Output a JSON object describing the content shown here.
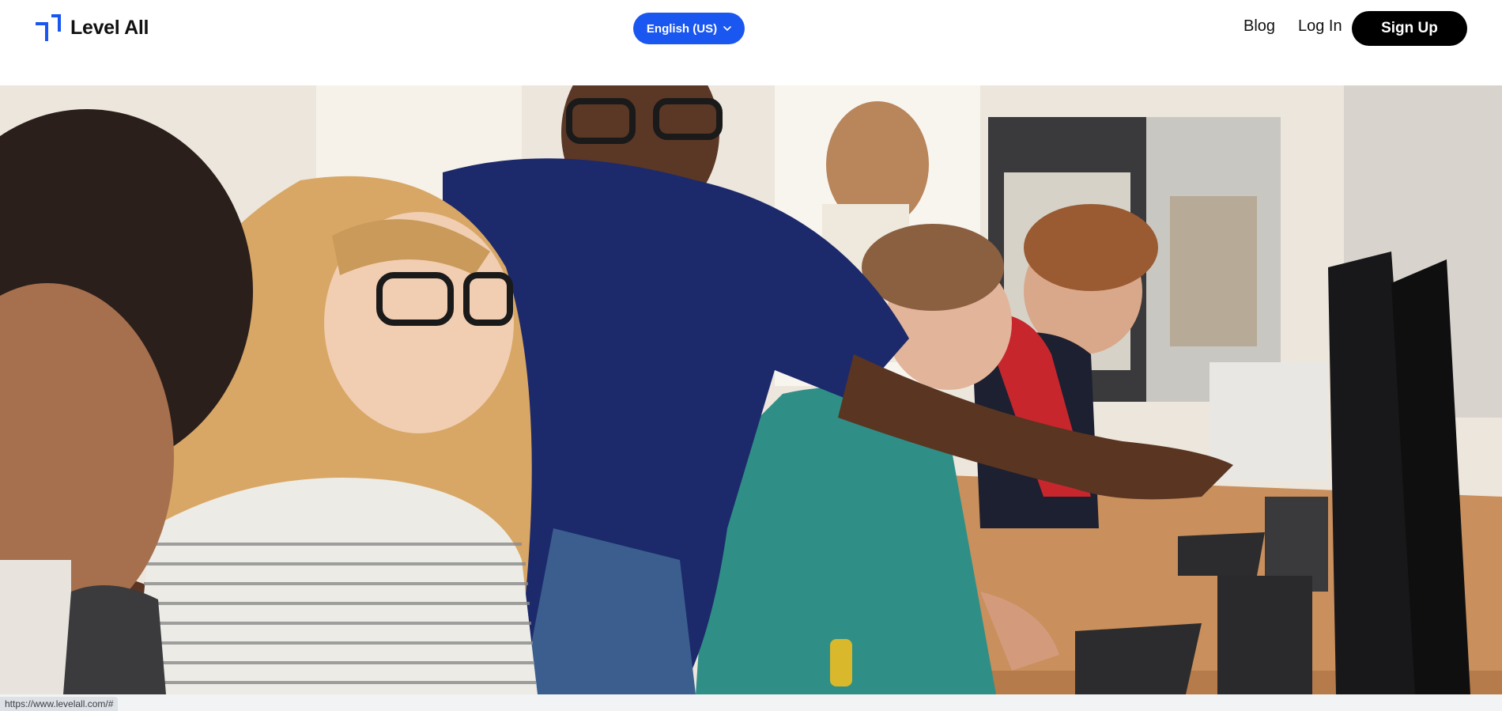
{
  "header": {
    "logo_text": "Level All",
    "language_label": "English (US)",
    "nav": {
      "blog": "Blog",
      "login": "Log In",
      "signup": "Sign Up"
    }
  },
  "hero": {
    "image_description_icon": "classroom-photo"
  },
  "status_bar": {
    "url": "https://www.levelall.com/#"
  },
  "colors": {
    "brand_blue": "#1a56f0",
    "signup_bg": "#000000",
    "text": "#111111"
  }
}
